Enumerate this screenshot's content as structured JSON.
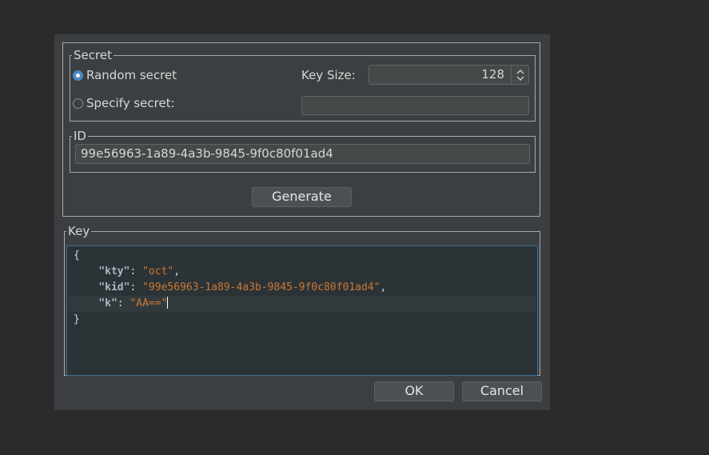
{
  "secret": {
    "legend": "Secret",
    "random_label": "Random secret",
    "specify_label": "Specify secret:",
    "specify_value": "",
    "key_size_label": "Key Size:",
    "key_size_value": "128"
  },
  "id": {
    "legend": "ID",
    "value": "99e56963-1a89-4a3b-9845-9f0c80f01ad4"
  },
  "generate_label": "Generate",
  "key": {
    "legend": "Key",
    "open_brace": "{",
    "close_brace": "}",
    "fields": [
      {
        "key": "\"kty\"",
        "value": "\"oct\"",
        "trail": ","
      },
      {
        "key": "\"kid\"",
        "value": "\"99e56963-1a89-4a3b-9845-9f0c80f01ad4\"",
        "trail": ","
      },
      {
        "key": "\"k\"",
        "value": "\"AA==\"",
        "trail": ""
      }
    ]
  },
  "ok_label": "OK",
  "cancel_label": "Cancel",
  "colors": {
    "accent": "#4a88c7",
    "json_key": "#a9b7c6",
    "json_string": "#cc7832",
    "background": "#3c3f41"
  }
}
